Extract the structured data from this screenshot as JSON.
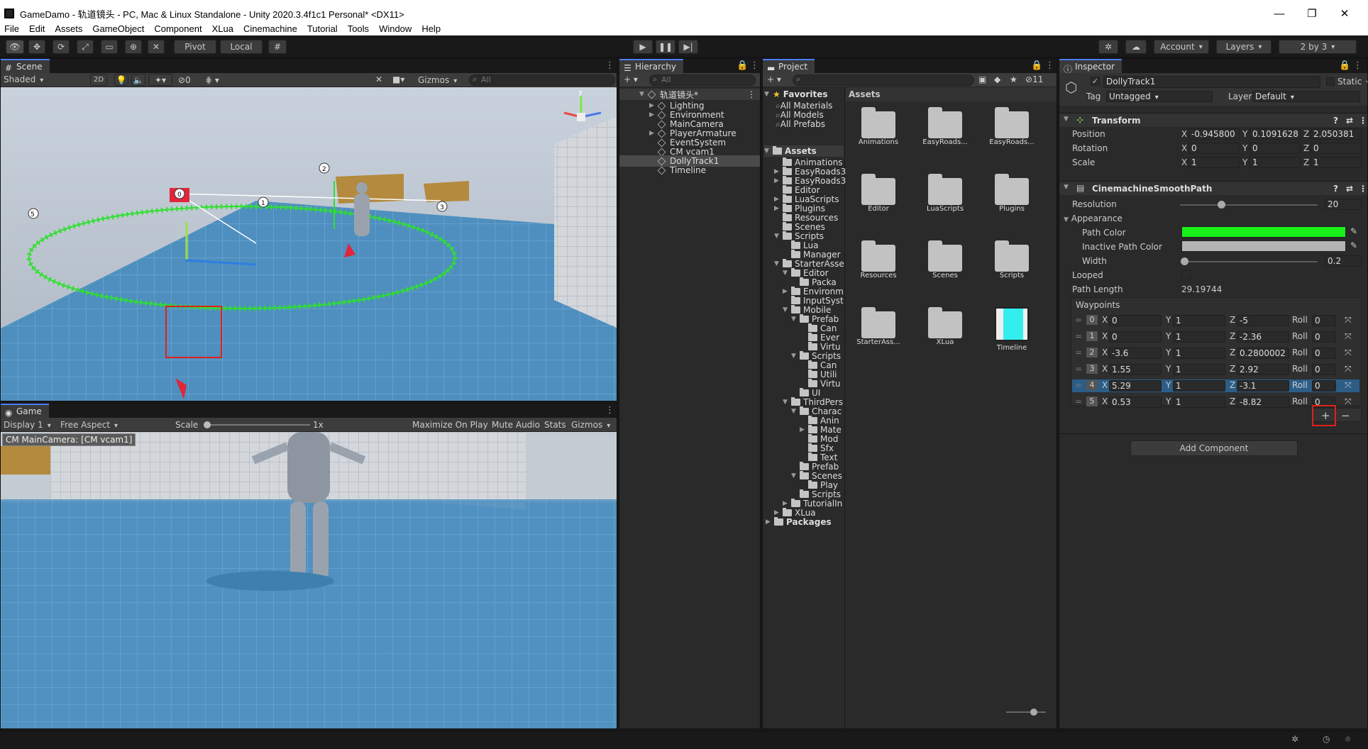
{
  "window": {
    "title": "GameDamo - 轨道镜头 - PC, Mac & Linux Standalone - Unity 2020.3.4f1c1 Personal* <DX11>"
  },
  "menu": [
    "File",
    "Edit",
    "Assets",
    "GameObject",
    "Component",
    "XLua",
    "Cinemachine",
    "Tutorial",
    "Tools",
    "Window",
    "Help"
  ],
  "toolbar": {
    "pivot": "Pivot",
    "local": "Local",
    "account": "Account",
    "layers": "Layers",
    "layout": "2 by 3"
  },
  "scene": {
    "tab": "Scene",
    "shading": "Shaded",
    "mode2d": "2D",
    "gizmos": "Gizmos",
    "search": "All",
    "hidden_count": "0",
    "waypoint_labels": [
      "0",
      "1",
      "2",
      "3",
      "5"
    ]
  },
  "game": {
    "tab": "Game",
    "display": "Display 1",
    "aspect": "Free Aspect",
    "scale_label": "Scale",
    "scale_value": "1x",
    "maximize": "Maximize On Play",
    "mute": "Mute Audio",
    "stats": "Stats",
    "gizmos": "Gizmos",
    "camera_label": "CM MainCamera: [CM vcam1]"
  },
  "hierarchy": {
    "tab": "Hierarchy",
    "search": "All",
    "scene": "轨道镜头*",
    "items": [
      {
        "label": "Lighting",
        "arrow": "▶"
      },
      {
        "label": "Environment",
        "arrow": "▶"
      },
      {
        "label": "MainCamera",
        "arrow": ""
      },
      {
        "label": "PlayerArmature",
        "arrow": "▶"
      },
      {
        "label": "EventSystem",
        "arrow": ""
      },
      {
        "label": "CM vcam1",
        "arrow": ""
      },
      {
        "label": "DollyTrack1",
        "arrow": ""
      },
      {
        "label": "Timeline",
        "arrow": ""
      }
    ]
  },
  "project": {
    "tab": "Project",
    "count": "11",
    "favorites": "Favorites",
    "fav_items": [
      "All Materials",
      "All Models",
      "All Prefabs"
    ],
    "assets_root": "Assets",
    "tree": [
      {
        "d": 1,
        "a": "",
        "t": "Animations"
      },
      {
        "d": 1,
        "a": "▶",
        "t": "EasyRoads3"
      },
      {
        "d": 1,
        "a": "▶",
        "t": "EasyRoads3"
      },
      {
        "d": 1,
        "a": "",
        "t": "Editor"
      },
      {
        "d": 1,
        "a": "▶",
        "t": "LuaScripts"
      },
      {
        "d": 1,
        "a": "▶",
        "t": "Plugins"
      },
      {
        "d": 1,
        "a": "",
        "t": "Resources"
      },
      {
        "d": 1,
        "a": "",
        "t": "Scenes"
      },
      {
        "d": 1,
        "a": "▼",
        "t": "Scripts"
      },
      {
        "d": 2,
        "a": "",
        "t": "Lua"
      },
      {
        "d": 2,
        "a": "",
        "t": "Manager"
      },
      {
        "d": 1,
        "a": "▼",
        "t": "StarterAsse"
      },
      {
        "d": 2,
        "a": "▼",
        "t": "Editor"
      },
      {
        "d": 3,
        "a": "",
        "t": "Packa"
      },
      {
        "d": 2,
        "a": "▶",
        "t": "Environm"
      },
      {
        "d": 2,
        "a": "",
        "t": "InputSyst"
      },
      {
        "d": 2,
        "a": "▼",
        "t": "Mobile"
      },
      {
        "d": 3,
        "a": "▼",
        "t": "Prefab"
      },
      {
        "d": 4,
        "a": "",
        "t": "Can"
      },
      {
        "d": 4,
        "a": "",
        "t": "Ever"
      },
      {
        "d": 4,
        "a": "",
        "t": "Virtu"
      },
      {
        "d": 3,
        "a": "▼",
        "t": "Scripts"
      },
      {
        "d": 4,
        "a": "",
        "t": "Can"
      },
      {
        "d": 4,
        "a": "",
        "t": "Utili"
      },
      {
        "d": 4,
        "a": "",
        "t": "Virtu"
      },
      {
        "d": 3,
        "a": "",
        "t": "UI"
      },
      {
        "d": 2,
        "a": "▼",
        "t": "ThirdPers"
      },
      {
        "d": 3,
        "a": "▼",
        "t": "Charac"
      },
      {
        "d": 4,
        "a": "",
        "t": "Anin"
      },
      {
        "d": 4,
        "a": "▶",
        "t": "Mate"
      },
      {
        "d": 4,
        "a": "",
        "t": "Mod"
      },
      {
        "d": 4,
        "a": "",
        "t": "Sfx"
      },
      {
        "d": 4,
        "a": "",
        "t": "Text"
      },
      {
        "d": 3,
        "a": "",
        "t": "Prefab"
      },
      {
        "d": 3,
        "a": "▼",
        "t": "Scenes"
      },
      {
        "d": 4,
        "a": "",
        "t": "Play"
      },
      {
        "d": 3,
        "a": "",
        "t": "Scripts"
      },
      {
        "d": 2,
        "a": "▶",
        "t": "TutorialIn"
      },
      {
        "d": 1,
        "a": "▶",
        "t": "XLua"
      },
      {
        "d": 0,
        "a": "▶",
        "t": "Packages"
      }
    ],
    "grid": [
      "Animations",
      "EasyRoads...",
      "EasyRoads...",
      "Editor",
      "LuaScripts",
      "Plugins",
      "Resources",
      "Scenes",
      "Scripts",
      "StarterAss...",
      "XLua",
      "Timeline"
    ]
  },
  "inspector": {
    "tab": "Inspector",
    "object_name": "DollyTrack1",
    "static": "Static",
    "tag_label": "Tag",
    "tag": "Untagged",
    "layer_label": "Layer",
    "layer": "Default",
    "transform": {
      "title": "Transform",
      "position": [
        "-0.945800",
        "0.1091628",
        "2.050381"
      ],
      "rotation": [
        "0",
        "0",
        "0"
      ],
      "scale": [
        "1",
        "1",
        "1"
      ],
      "labels": [
        "Position",
        "Rotation",
        "Scale"
      ]
    },
    "path": {
      "title": "CinemachineSmoothPath",
      "resolution_label": "Resolution",
      "resolution": "20",
      "resolution_level": 0.05,
      "appearance": "Appearance",
      "path_color_label": "Path Color",
      "path_color": "#19f019",
      "inactive_label": "Inactive Path Color",
      "inactive_color": "#b4b4b4",
      "width_label": "Width",
      "width": "0.2",
      "width_level": 0.02,
      "looped_label": "Looped",
      "length_label": "Path Length",
      "length": "29.19744",
      "waypoints_label": "Waypoints",
      "waypoints": [
        {
          "i": "0",
          "x": "0",
          "y": "1",
          "z": "-5",
          "roll": "0"
        },
        {
          "i": "1",
          "x": "0",
          "y": "1",
          "z": "-2.36",
          "roll": "0"
        },
        {
          "i": "2",
          "x": "-3.6",
          "y": "1",
          "z": "0.2800002",
          "roll": "0"
        },
        {
          "i": "3",
          "x": "1.55",
          "y": "1",
          "z": "2.92",
          "roll": "0"
        },
        {
          "i": "4",
          "x": "5.29",
          "y": "1",
          "z": "-3.1",
          "roll": "0"
        },
        {
          "i": "5",
          "x": "0.53",
          "y": "1",
          "z": "-8.82",
          "roll": "0"
        }
      ]
    },
    "add_component": "Add Component"
  },
  "accent": "#4c7eff"
}
